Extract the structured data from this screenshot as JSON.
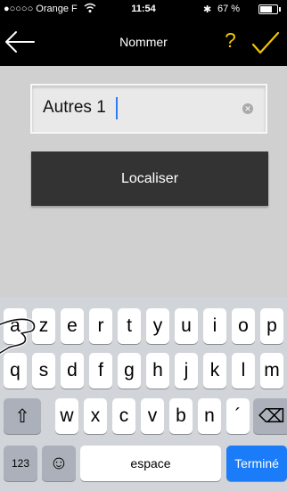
{
  "status_bar": {
    "carrier": "●○○○○ Orange F",
    "time": "11:54",
    "bluetooth": "✱",
    "battery_percent": "67 %",
    "battery_level": 0.67
  },
  "nav": {
    "title": "Nommer",
    "back_icon": "back-arrow-icon",
    "help_label": "?",
    "confirm_icon": "checkmark-icon",
    "accent_color": "#f2c600"
  },
  "form": {
    "name_value": "Autres 1",
    "clear_icon": "⊗",
    "locate_label": "Localiser"
  },
  "keyboard": {
    "row1": [
      "a",
      "z",
      "e",
      "r",
      "t",
      "y",
      "u",
      "i",
      "o",
      "p"
    ],
    "row2": [
      "q",
      "s",
      "d",
      "f",
      "g",
      "h",
      "j",
      "k",
      "l",
      "m"
    ],
    "row3": [
      "w",
      "x",
      "c",
      "v",
      "b",
      "n",
      "´"
    ],
    "shift_icon": "⇧",
    "delete_icon": "⌫",
    "numbers_label": "123",
    "emoji_icon": "☺",
    "space_label": "espace",
    "done_label": "Terminé",
    "done_color": "#1a7cf8"
  }
}
